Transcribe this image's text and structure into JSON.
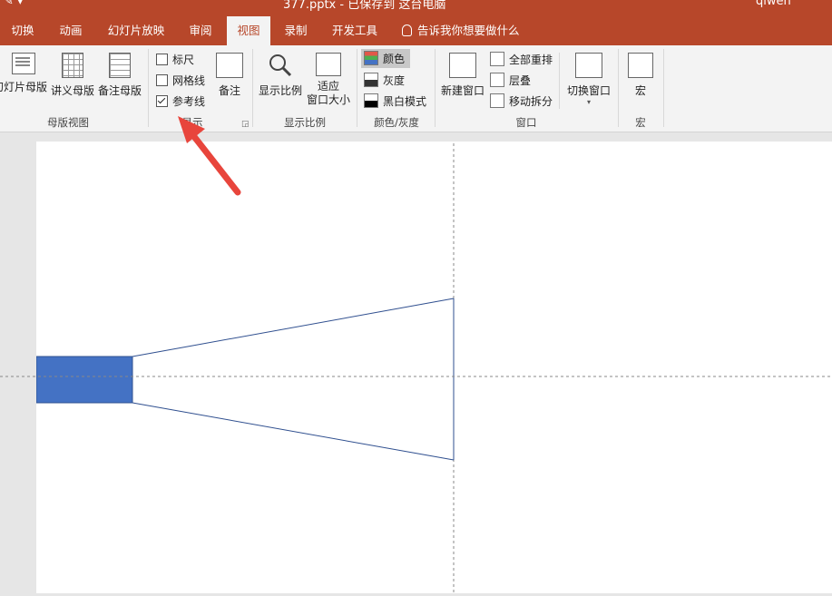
{
  "titlebar": {
    "doc_title": "377.pptx - 已保存到 这台电脑",
    "user": "qiwen"
  },
  "tabs": [
    "切换",
    "动画",
    "幻灯片放映",
    "审阅",
    "视图",
    "录制",
    "开发工具"
  ],
  "active_tab": "视图",
  "tell_me": "告诉我你想要做什么",
  "ribbon": {
    "master_views": {
      "buttons": [
        "幻灯片母版",
        "讲义母版",
        "备注母版"
      ],
      "label": "母版视图"
    },
    "show": {
      "checkboxes": [
        {
          "label": "标尺",
          "checked": false
        },
        {
          "label": "网格线",
          "checked": false
        },
        {
          "label": "参考线",
          "checked": true
        }
      ],
      "notes_button": "备注",
      "label": "显示"
    },
    "zoom": {
      "zoom_button": "显示比例",
      "fit_button_line1": "适应",
      "fit_button_line2": "窗口大小",
      "label": "显示比例"
    },
    "color": {
      "options": [
        {
          "label": "颜色",
          "selected": true
        },
        {
          "label": "灰度",
          "selected": false
        },
        {
          "label": "黑白模式",
          "selected": false
        }
      ],
      "label": "颜色/灰度"
    },
    "window": {
      "new_window": "新建窗口",
      "arrange_all": "全部重排",
      "cascade": "层叠",
      "move_split": "移动拆分",
      "switch_windows": "切换窗口",
      "label": "窗口"
    },
    "macros": {
      "button": "宏",
      "label": "宏"
    }
  },
  "colors": {
    "accent": "#b7472a",
    "shape_fill": "#4472c4",
    "arrow": "#e8453c"
  }
}
